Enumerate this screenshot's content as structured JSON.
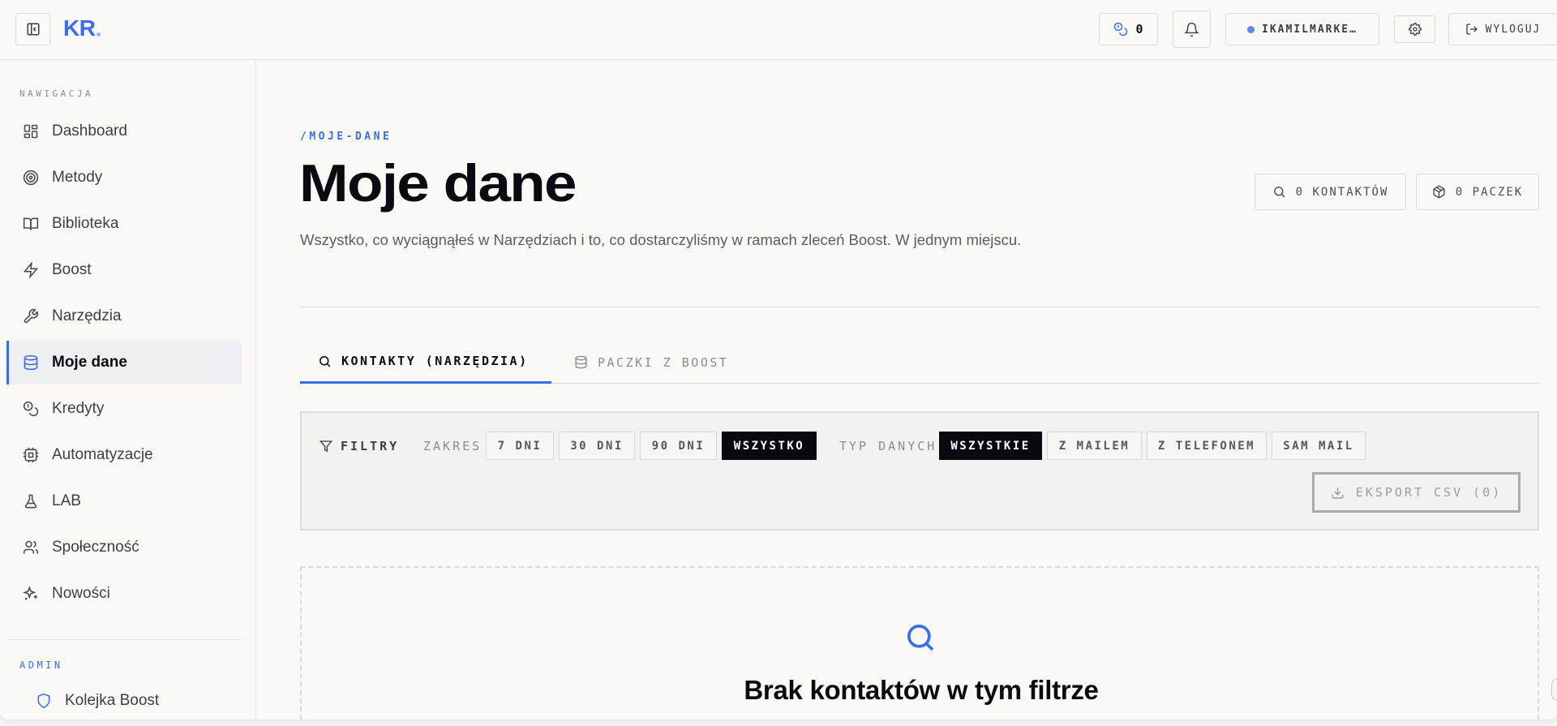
{
  "topbar": {
    "logo": "KR",
    "credits_value": "0",
    "user_label": "IKAMILMARKE…",
    "logout_label": "WYLOGUJ"
  },
  "sidebar": {
    "nav_heading": "NAWIGACJA",
    "items": [
      {
        "label": "Dashboard",
        "icon": "dashboard-icon"
      },
      {
        "label": "Metody",
        "icon": "target-icon"
      },
      {
        "label": "Biblioteka",
        "icon": "book-icon"
      },
      {
        "label": "Boost",
        "icon": "lightning-icon"
      },
      {
        "label": "Narzędzia",
        "icon": "wrench-icon"
      },
      {
        "label": "Moje dane",
        "icon": "database-icon",
        "active": true
      },
      {
        "label": "Kredyty",
        "icon": "coins-icon"
      },
      {
        "label": "Automatyzacje",
        "icon": "cpu-icon"
      },
      {
        "label": "LAB",
        "icon": "flask-icon"
      },
      {
        "label": "Społeczność",
        "icon": "users-icon"
      },
      {
        "label": "Nowości",
        "icon": "sparkles-icon"
      }
    ],
    "admin_heading": "ADMIN",
    "admin_items": [
      {
        "label": "Kolejka Boost",
        "icon": "shield-icon"
      }
    ]
  },
  "page": {
    "breadcrumb": "/MOJE-DANE",
    "title": "Moje dane",
    "description": "Wszystko, co wyciągnąłeś w Narzędziach i to, co dostarczyliśmy w ramach zleceń Boost. W jednym miejscu.",
    "stats": {
      "contacts": "0 KONTAKTÓW",
      "packs": "0 PACZEK"
    }
  },
  "tabs": [
    {
      "label": "KONTAKTY (NARZĘDZIA)",
      "active": true
    },
    {
      "label": "PACZKI Z BOOST",
      "active": false
    }
  ],
  "filters": {
    "title": "FILTRY",
    "range_label": "ZAKRES",
    "range_options": [
      "7 DNI",
      "30 DNI",
      "90 DNI",
      "WSZYSTKO"
    ],
    "range_selected": "WSZYSTKO",
    "type_label": "TYP DANYCH",
    "type_options": [
      "WSZYSTKIE",
      "Z MAILEM",
      "Z TELEFONEM",
      "SAM MAIL"
    ],
    "type_selected": "WSZYSTKIE",
    "export_label": "EKSPORT CSV (0)"
  },
  "empty_state": {
    "title": "Brak kontaktów w tym filtrze"
  },
  "colors": {
    "accent": "#3b6ee6",
    "selected_chip": "#07090f",
    "background": "#faf9f6"
  }
}
